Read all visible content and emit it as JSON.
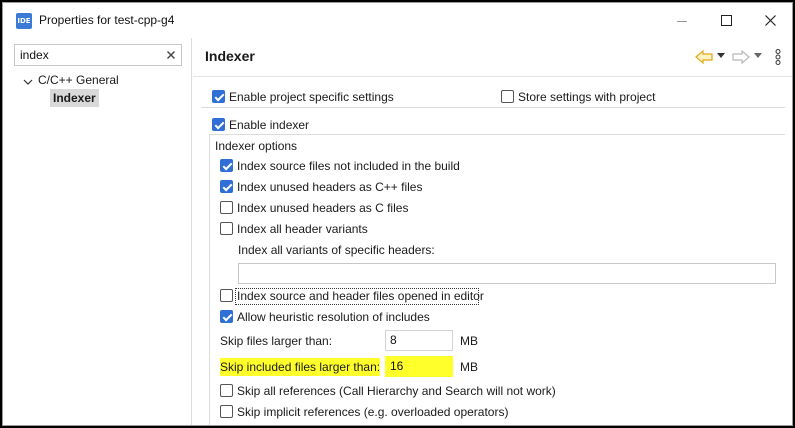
{
  "window": {
    "title": "Properties for test-cpp-g4",
    "app_icon_text": "IDE",
    "icons": [
      "minimize-icon",
      "maximize-icon",
      "close-icon"
    ]
  },
  "sidebar": {
    "filter_value": "index",
    "tree": [
      {
        "label": "C/C++ General",
        "expanded": true
      },
      {
        "label": "Indexer",
        "selected": true
      }
    ]
  },
  "page": {
    "title": "Indexer",
    "toolbar_icons": [
      "back-arrow-icon",
      "forward-arrow-icon",
      "view-menu-icon"
    ]
  },
  "settings": {
    "enable_project_specific": {
      "label": "Enable project specific settings",
      "checked": true
    },
    "store_with_project": {
      "label": "Store settings with project",
      "checked": false
    },
    "enable_indexer": {
      "label": "Enable indexer",
      "checked": true
    },
    "group_title": "Indexer options",
    "options": [
      {
        "label": "Index source files not included in the build",
        "checked": true
      },
      {
        "label": "Index unused headers as C++ files",
        "checked": true
      },
      {
        "label": "Index unused headers as C files",
        "checked": false
      },
      {
        "label": "Index all header variants",
        "checked": false
      }
    ],
    "variants_label": "Index all variants of specific headers:",
    "variants_value": "",
    "index_opened_in_editor": {
      "label": "Index source and header files opened in editor",
      "checked": false
    },
    "heuristic": {
      "label": "Allow heuristic resolution of includes",
      "checked": true
    },
    "skip_files_larger": {
      "label": "Skip files larger than:",
      "value": "8",
      "unit": "MB"
    },
    "skip_included_larger": {
      "label": "Skip included files larger than:",
      "value": "16",
      "unit": "MB",
      "highlight_color": "#ffff2b"
    },
    "skip_all_refs": {
      "label": "Skip all references (Call Hierarchy and Search will not work)",
      "checked": false
    },
    "skip_implicit_refs": {
      "label": "Skip implicit references (e.g. overloaded operators)",
      "checked": false
    }
  },
  "colors": {
    "accent": "#2f6fd6",
    "highlight": "#ffff2b",
    "nav_back_arrow": "#e0a818"
  }
}
